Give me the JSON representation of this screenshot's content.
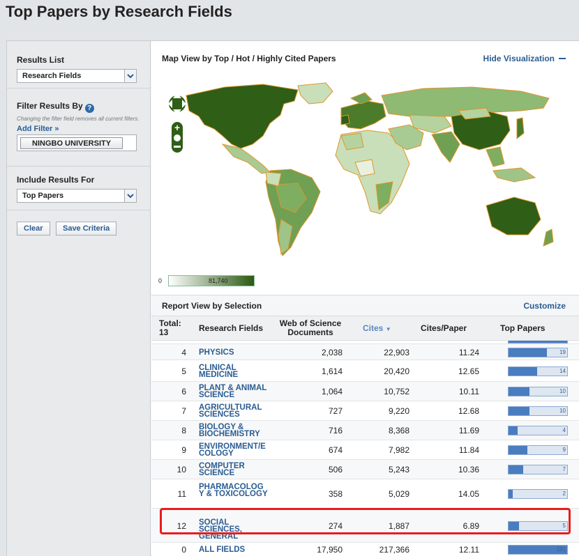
{
  "page_title": "Top Papers by Research Fields",
  "sidebar": {
    "results_list_label": "Results List",
    "results_list_value": "Research Fields",
    "filter_label": "Filter Results By",
    "filter_help_glyph": "?",
    "filter_note": "Changing the filter field removes all current filters.",
    "add_filter": "Add Filter »",
    "active_filter": "NINGBO UNIVERSITY",
    "include_label": "Include Results For",
    "include_value": "Top Papers",
    "clear_button": "Clear",
    "save_button": "Save Criteria"
  },
  "map": {
    "title": "Map View by Top / Hot / Highly Cited Papers",
    "hide_label": "Hide Visualization",
    "legend_min": "0",
    "legend_max": "81,740",
    "colors": {
      "dark": "#2f5e16",
      "mid": "#6fa053",
      "light": "#c9dfb9",
      "border": "#e0952a",
      "ocean": "#ffffff"
    }
  },
  "report": {
    "title": "Report View by Selection",
    "customize_label": "Customize",
    "columns": {
      "total": "Total:",
      "total_count": "13",
      "field": "Research Fields",
      "docs": "Web of Science Documents",
      "cites": "Cites",
      "cites_paper": "Cites/Paper",
      "top_papers": "Top Papers"
    },
    "rows": [
      {
        "rank": "4",
        "field": "PHYSICS",
        "docs": "2,038",
        "cites": "22,903",
        "cpp": "11.24",
        "top": "19",
        "top_frac": 0.65
      },
      {
        "rank": "5",
        "field": "CLINICAL MEDICINE",
        "docs": "1,614",
        "cites": "20,420",
        "cpp": "12.65",
        "top": "14",
        "top_frac": 0.49
      },
      {
        "rank": "6",
        "field": "PLANT & ANIMAL SCIENCE",
        "docs": "1,064",
        "cites": "10,752",
        "cpp": "10.11",
        "top": "10",
        "top_frac": 0.36
      },
      {
        "rank": "7",
        "field": "AGRICULTURAL SCIENCES",
        "docs": "727",
        "cites": "9,220",
        "cpp": "12.68",
        "top": "10",
        "top_frac": 0.36
      },
      {
        "rank": "8",
        "field": "BIOLOGY & BIOCHEMISTRY",
        "docs": "716",
        "cites": "8,368",
        "cpp": "11.69",
        "top": "4",
        "top_frac": 0.15
      },
      {
        "rank": "9",
        "field": "ENVIRONMENT/E COLOGY",
        "docs": "674",
        "cites": "7,982",
        "cpp": "11.84",
        "top": "9",
        "top_frac": 0.32
      },
      {
        "rank": "10",
        "field": "COMPUTER SCIENCE",
        "docs": "506",
        "cites": "5,243",
        "cpp": "10.36",
        "top": "7",
        "top_frac": 0.25
      },
      {
        "rank": "11",
        "field": "PHARMACOLOG Y & TOXICOLOGY",
        "docs": "358",
        "cites": "5,029",
        "cpp": "14.05",
        "top": "2",
        "top_frac": 0.07
      },
      {
        "rank": "12",
        "field": "SOCIAL SCIENCES, GENERAL",
        "docs": "274",
        "cites": "1,887",
        "cpp": "6.89",
        "top": "5",
        "top_frac": 0.18
      },
      {
        "rank": "0",
        "field": "ALL FIELDS",
        "docs": "17,950",
        "cites": "217,366",
        "cpp": "12.11",
        "top": "181",
        "top_frac": 1.0
      }
    ]
  }
}
